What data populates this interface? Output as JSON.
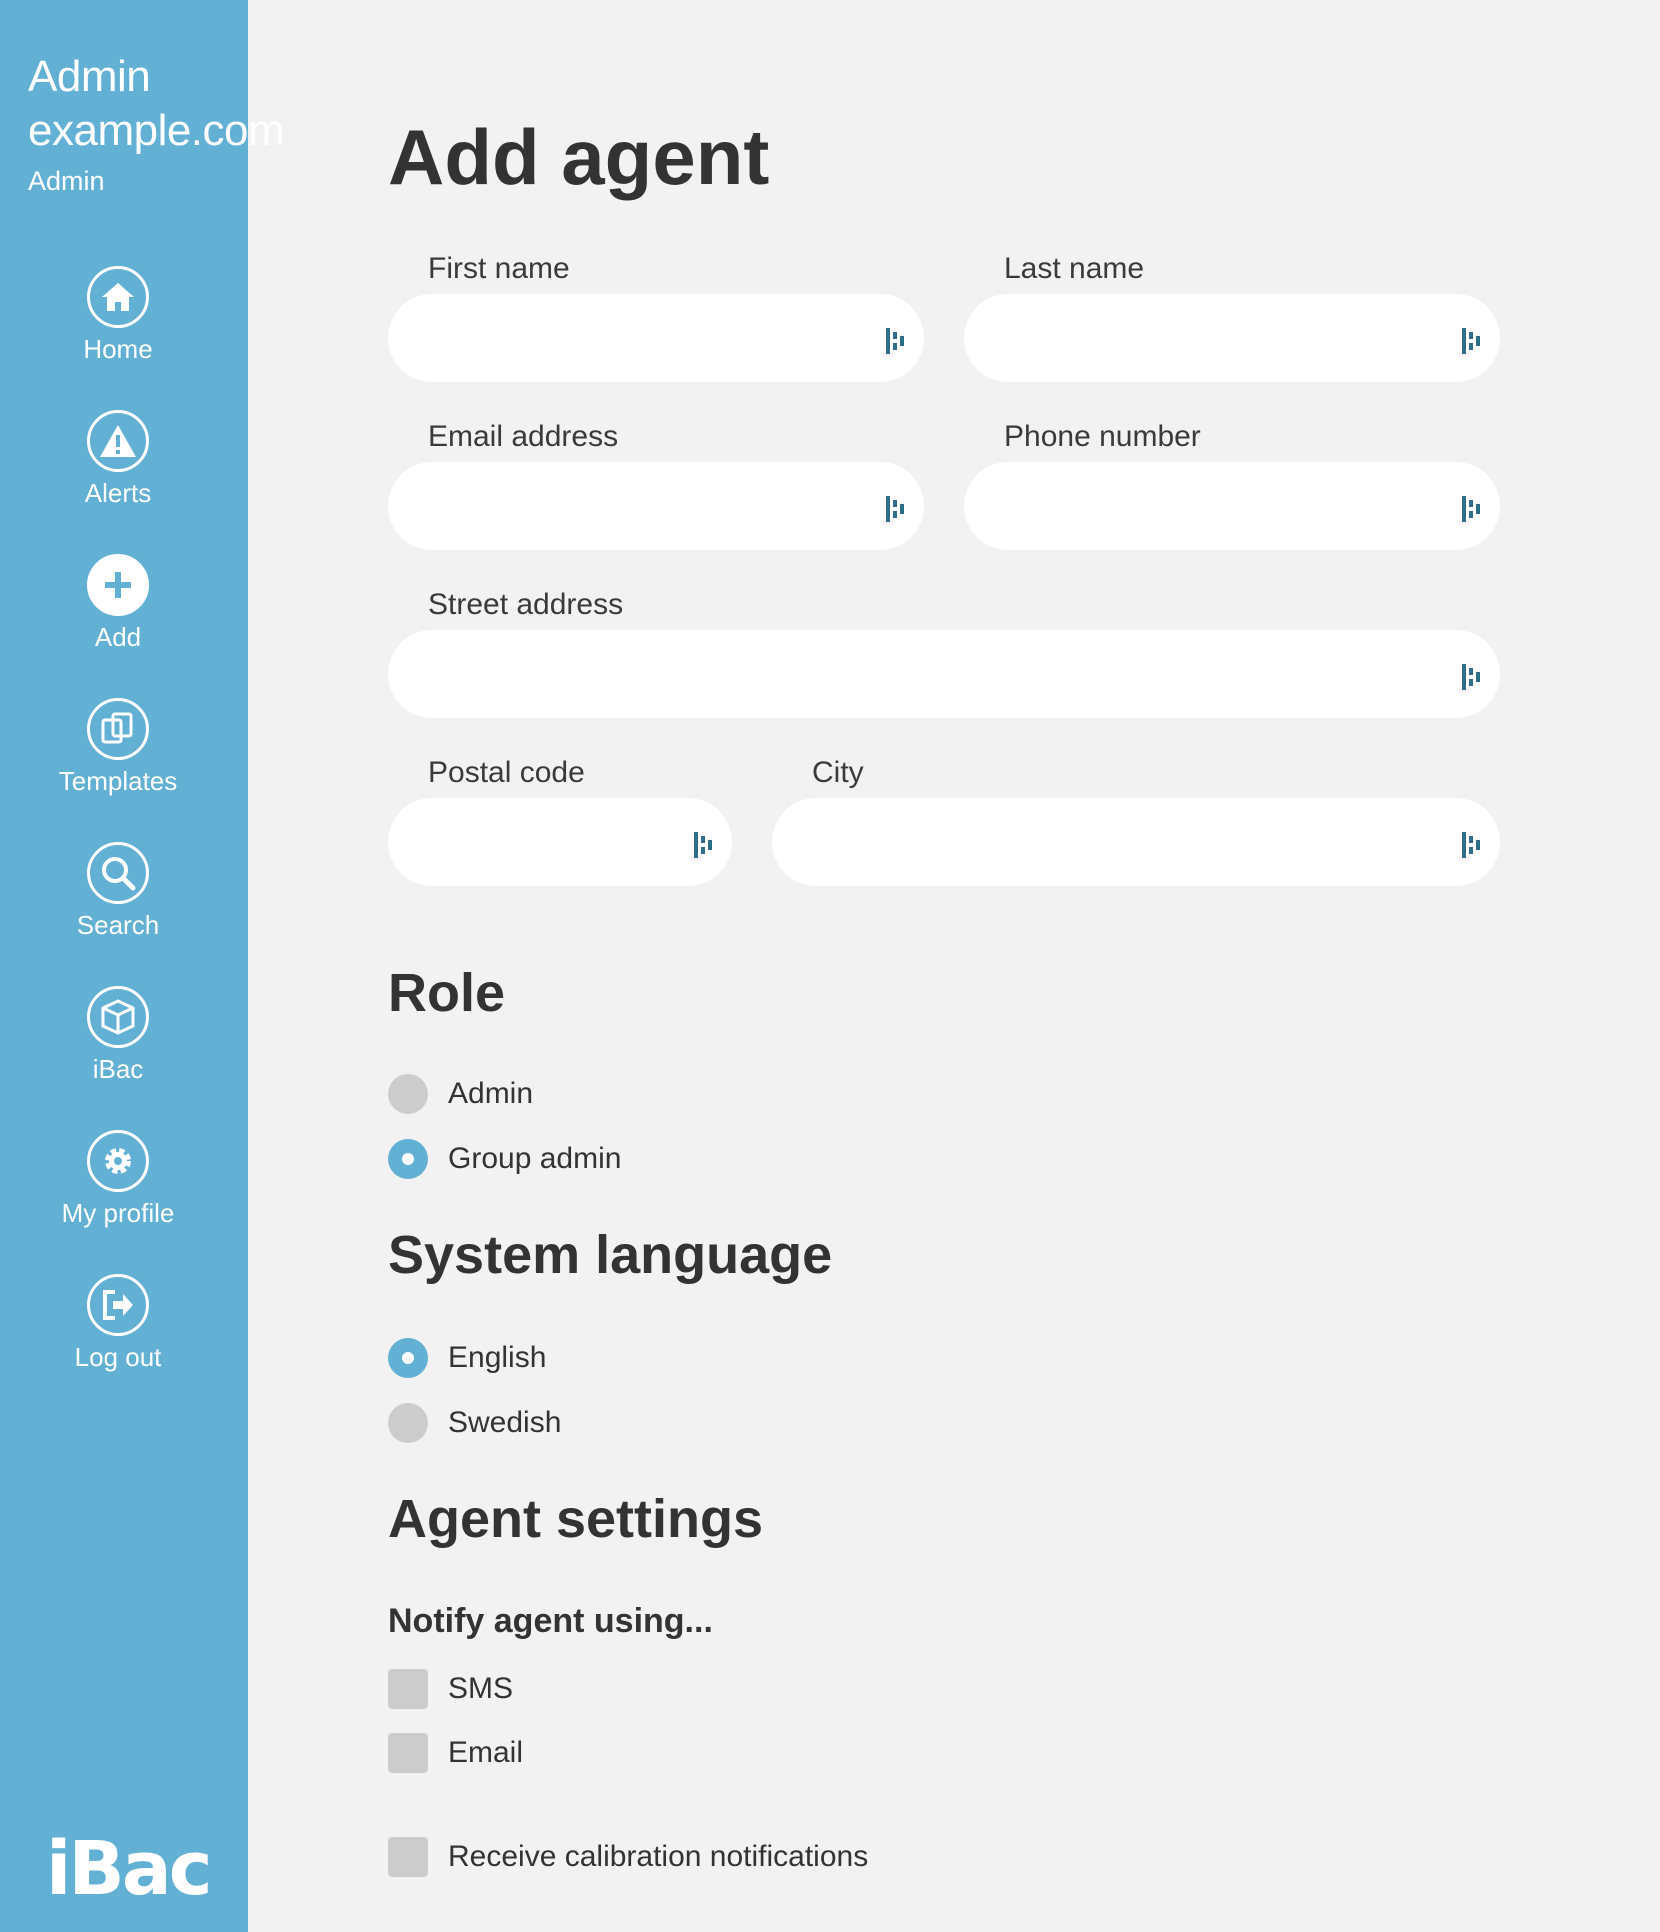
{
  "sidebar": {
    "account_name": "Admin example.com",
    "account_role": "Admin",
    "nav": [
      {
        "label": "Home",
        "icon": "home-icon"
      },
      {
        "label": "Alerts",
        "icon": "alert-icon"
      },
      {
        "label": "Add",
        "icon": "plus-icon"
      },
      {
        "label": "Templates",
        "icon": "templates-icon"
      },
      {
        "label": "Search",
        "icon": "search-icon"
      },
      {
        "label": "iBac",
        "icon": "box-icon"
      },
      {
        "label": "My profile",
        "icon": "gear-icon"
      },
      {
        "label": "Log out",
        "icon": "logout-icon"
      }
    ],
    "logo_text": "iBac"
  },
  "form": {
    "title": "Add agent",
    "fields": {
      "first_name": {
        "label": "First name",
        "value": ""
      },
      "last_name": {
        "label": "Last name",
        "value": ""
      },
      "email": {
        "label": "Email address",
        "value": ""
      },
      "phone": {
        "label": "Phone number",
        "value": ""
      },
      "street": {
        "label": "Street address",
        "value": ""
      },
      "postal": {
        "label": "Postal code",
        "value": ""
      },
      "city": {
        "label": "City",
        "value": ""
      }
    },
    "role": {
      "title": "Role",
      "options": [
        {
          "label": "Admin",
          "checked": false
        },
        {
          "label": "Group admin",
          "checked": true
        }
      ]
    },
    "language": {
      "title": "System language",
      "options": [
        {
          "label": "English",
          "checked": true
        },
        {
          "label": "Swedish",
          "checked": false
        }
      ]
    },
    "agent_settings": {
      "title": "Agent settings",
      "notify_title": "Notify agent using...",
      "notify_options": [
        {
          "label": "SMS",
          "checked": false
        },
        {
          "label": "Email",
          "checked": false
        }
      ],
      "calibration": {
        "label": "Receive calibration notifications",
        "checked": false
      }
    }
  },
  "colors": {
    "sidebar": "#62b0d3",
    "background": "#f2f2f2",
    "accent": "#62b0d3",
    "field_icon": "#2e6e86"
  }
}
